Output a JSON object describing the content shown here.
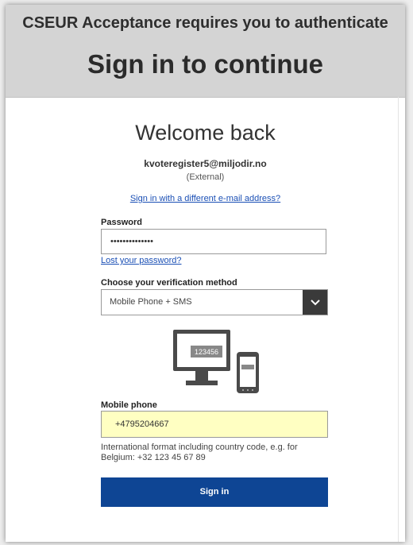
{
  "banner": {
    "subtitle": "CSEUR Acceptance requires you to authenticate",
    "title": "Sign in to continue"
  },
  "account": {
    "welcome": "Welcome back",
    "email": "kvoteregister5@miljodir.no",
    "type": "(External)",
    "different_email_link": "Sign in with a different e-mail address?"
  },
  "password": {
    "label": "Password",
    "value": "••••••••••••••",
    "lost_link": "Lost your password?"
  },
  "verification": {
    "label": "Choose your verification method",
    "selected": "Mobile Phone + SMS",
    "device_code": "123456"
  },
  "mobile": {
    "label": "Mobile phone",
    "value": "+4795204667",
    "hint": "International format including country code, e.g. for Belgium: +32 123 45 67 89"
  },
  "submit": {
    "label": "Sign in"
  },
  "colors": {
    "banner": "#d4d4d4",
    "primary": "#0e4594",
    "link": "#1a4fb5",
    "highlight": "#ffffc2"
  }
}
